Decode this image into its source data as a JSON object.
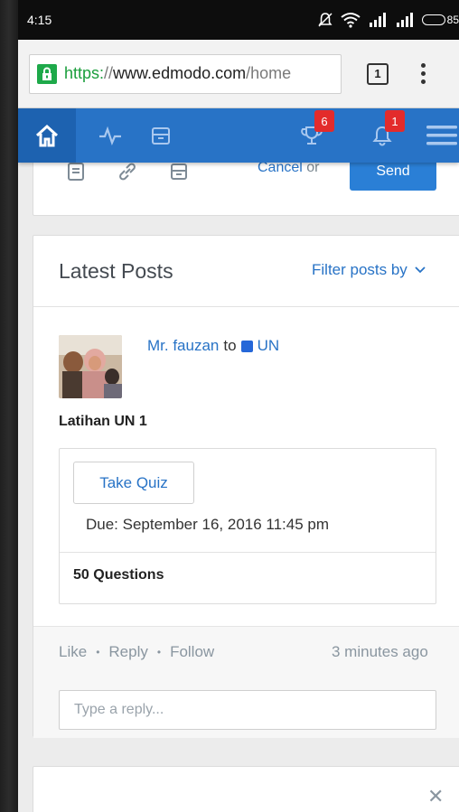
{
  "status_bar": {
    "time": "4:15",
    "battery_text": "85",
    "battery_level": 0.85
  },
  "browser": {
    "url_scheme": "https:",
    "url_sep": "//",
    "url_host": "www.edmodo.com",
    "url_path": "/home",
    "tab_count": "1"
  },
  "app_nav": {
    "badges_trophy": "6",
    "badges_bell": "1"
  },
  "composer": {
    "cancel_label": "Cancel",
    "or_label": "or",
    "send_label": "Send"
  },
  "posts": {
    "title": "Latest Posts",
    "filter_label": "Filter posts by",
    "post": {
      "author": "Mr. fauzan",
      "to_label": "to",
      "group": "UN",
      "title": "Latihan UN 1",
      "quiz_button": "Take Quiz",
      "due": "Due: September 16, 2016 11:45 pm",
      "questions": "50 Questions",
      "like": "Like",
      "reply": "Reply",
      "follow": "Follow",
      "bullet": "•",
      "timestamp": "3 minutes ago",
      "reply_placeholder": "Type a reply..."
    }
  },
  "bottom_card": {
    "close_symbol": "✕"
  },
  "colors": {
    "accent": "#2873c6",
    "badge": "#e32b2b",
    "secure": "#1ea94a"
  }
}
